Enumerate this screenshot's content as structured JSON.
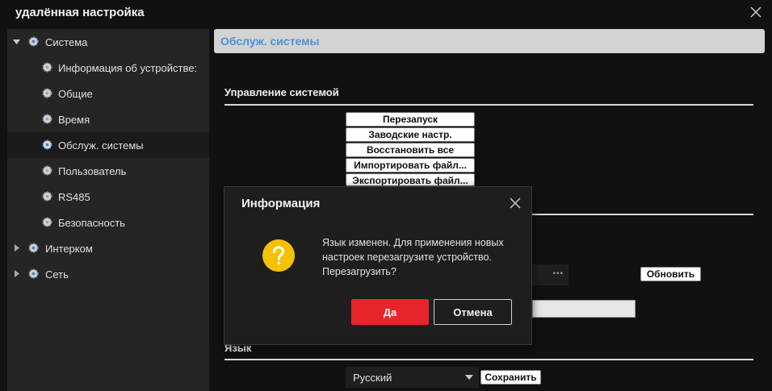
{
  "window": {
    "title": "удалённая настройка",
    "close_icon": "close-icon"
  },
  "sidebar": {
    "items": [
      {
        "label": "Система",
        "level": 0,
        "expanded": true
      },
      {
        "label": "Информация об устройстве:",
        "level": 1
      },
      {
        "label": "Общие",
        "level": 1
      },
      {
        "label": "Время",
        "level": 1
      },
      {
        "label": "Обслуж. системы",
        "level": 1,
        "selected": true
      },
      {
        "label": "Пользователь",
        "level": 1
      },
      {
        "label": "RS485",
        "level": 1
      },
      {
        "label": "Безопасность",
        "level": 1
      },
      {
        "label": "Интерком",
        "level": 0,
        "expanded": false
      },
      {
        "label": "Сеть",
        "level": 0,
        "expanded": false
      }
    ]
  },
  "content": {
    "header": "Обслуж. системы",
    "system_management": {
      "title": "Управление системой",
      "buttons": [
        "Перезапуск",
        "Заводские настр.",
        "Восстановить все",
        "Импортировать файл...",
        "Экспортировать файл..."
      ]
    },
    "password_mask": "•••",
    "update_button": "Обновить",
    "language": {
      "title": "Язык",
      "selected": "Русский",
      "save_button": "Сохранить"
    }
  },
  "dialog": {
    "title": "Информация",
    "message": "Язык изменен. Для применения новых настроек перезагрузите устройство. Перезагрузить?",
    "icon": "question-icon",
    "yes_button": "Да",
    "cancel_button": "Отмена"
  },
  "colors": {
    "accent_red": "#e8242b",
    "header_text_blue": "#4e8fd6",
    "question_yellow": "#f5c100"
  }
}
